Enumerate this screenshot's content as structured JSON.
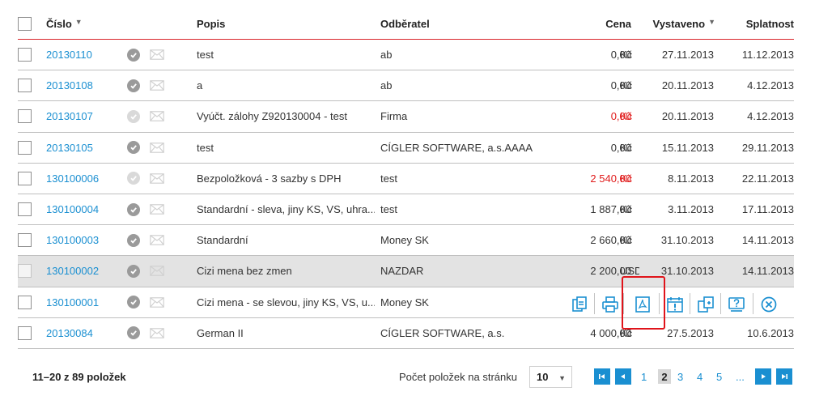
{
  "header": {
    "cislo": "Číslo",
    "popis": "Popis",
    "odberatel": "Odběratel",
    "cena": "Cena",
    "vystaveno": "Vystaveno",
    "splatnost": "Splatnost",
    "sort_arrow": "▼"
  },
  "rows": [
    {
      "number": "20130110",
      "status": "dark",
      "description": "test",
      "customer": "ab",
      "price": "0,00",
      "currency": "Kč",
      "price_red": false,
      "issued": "27.11.2013",
      "due": "11.12.2013"
    },
    {
      "number": "20130108",
      "status": "dark",
      "description": "a",
      "customer": "ab",
      "price": "0,00",
      "currency": "Kč",
      "price_red": false,
      "issued": "20.11.2013",
      "due": "4.12.2013"
    },
    {
      "number": "20130107",
      "status": "light",
      "description": "Vyúčt. zálohy Z920130004 - test",
      "customer": "Firma",
      "price": "0,00",
      "currency": "Kč",
      "price_red": true,
      "issued": "20.11.2013",
      "due": "4.12.2013"
    },
    {
      "number": "20130105",
      "status": "dark",
      "description": "test",
      "customer": "CÍGLER SOFTWARE, a.s.AAAA",
      "price": "0,00",
      "currency": "Kč",
      "price_red": false,
      "issued": "15.11.2013",
      "due": "29.11.2013"
    },
    {
      "number": "130100006",
      "status": "light",
      "description": "Bezpoložková - 3 sazby s DPH",
      "customer": "test",
      "price": "2 540,00",
      "currency": "Kč",
      "price_red": true,
      "issued": "8.11.2013",
      "due": "22.11.2013"
    },
    {
      "number": "130100004",
      "status": "dark",
      "description": "Standardní - sleva, jiny KS, VS, uhra...",
      "customer": "test",
      "price": "1 887,00",
      "currency": "Kč",
      "price_red": false,
      "issued": "3.11.2013",
      "due": "17.11.2013"
    },
    {
      "number": "130100003",
      "status": "dark",
      "description": "Standardní",
      "customer": "Money SK",
      "price": "2 660,00",
      "currency": "Kč",
      "price_red": false,
      "issued": "31.10.2013",
      "due": "14.11.2013"
    },
    {
      "number": "130100002",
      "status": "dark",
      "description": "Cizi mena bez zmen",
      "customer": "NAZDAR",
      "price": "2 200,00",
      "currency": "USD",
      "price_red": false,
      "issued": "31.10.2013",
      "due": "14.11.2013"
    },
    {
      "number": "130100001",
      "status": "dark",
      "description": "Cizi mena - se slevou, jiny KS, VS, u...",
      "customer": "Money SK",
      "price": "",
      "currency": "",
      "price_red": false,
      "issued": "",
      "due": ""
    },
    {
      "number": "20130084",
      "status": "dark",
      "description": "German II",
      "customer": "CÍGLER SOFTWARE, a.s.",
      "price": "4 000,00",
      "currency": "Kč",
      "price_red": false,
      "issued": "27.5.2013",
      "due": "10.6.2013"
    }
  ],
  "row_actions": [
    "copy-icon",
    "print-icon",
    "pdf-icon",
    "calendar-alert-icon",
    "duplicate-icon",
    "help-icon",
    "close-circle-icon"
  ],
  "footer": {
    "count": "11–20 z 89 položek",
    "per_page_label": "Počet položek na stránku",
    "per_page_value": "10",
    "pages": [
      "1",
      "2",
      "3",
      "4",
      "5",
      "..."
    ],
    "current_page": "2"
  },
  "colors": {
    "link": "#1a8fd1",
    "accent_red": "#e01b1b",
    "header_line": "#d9262b"
  }
}
